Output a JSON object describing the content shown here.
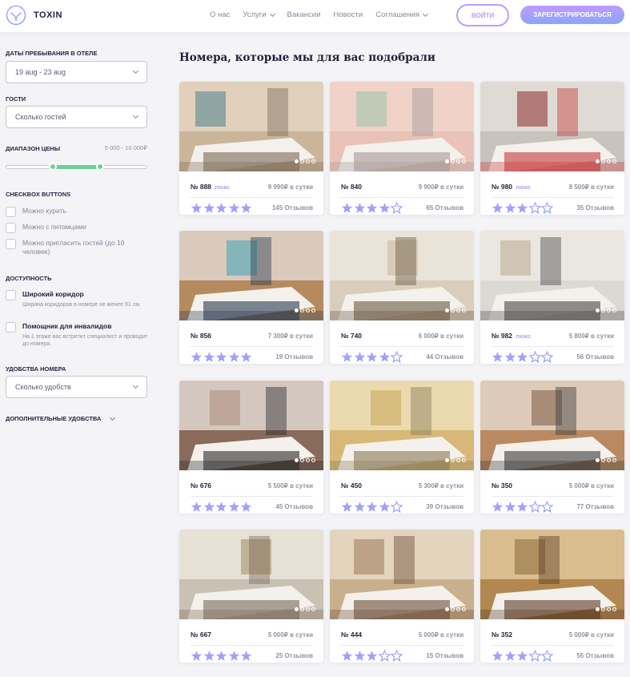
{
  "header": {
    "logo_text": "TOXIN",
    "nav": [
      {
        "label": "О нас",
        "dropdown": false
      },
      {
        "label": "Услуги",
        "dropdown": true
      },
      {
        "label": "Вакансии",
        "dropdown": false
      },
      {
        "label": "Новости",
        "dropdown": false
      },
      {
        "label": "Соглашения",
        "dropdown": true
      }
    ],
    "login_label": "войти",
    "register_label": "зарегистрироваться"
  },
  "sidebar": {
    "dates_heading": "Даты пребывания в отеле",
    "dates_value": "19 aug - 23 aug",
    "guests_heading": "Гости",
    "guests_placeholder": "Сколько гостей",
    "price_heading": "Диапазон цены",
    "price_range": "5 000 - 10 000₽",
    "price_slider": {
      "min": 0,
      "max": 15000,
      "from": 5000,
      "to": 10000
    },
    "checkboxes_heading": "checkbox buttons",
    "checkboxes": [
      {
        "label": "Можно курить",
        "checked": false
      },
      {
        "label": "Можно с питомцами",
        "checked": false
      },
      {
        "label": "Можно пригласить гостей (до 10 человек)",
        "checked": false
      }
    ],
    "accessibility_heading": "Доступность",
    "accessibility": [
      {
        "title": "Широкий коридор",
        "description": "Ширина коридоров в номере не менее 91 см.",
        "checked": false
      },
      {
        "title": "Помощник для инвалидов",
        "description": "На 1 этаже вас встретит специалист и проводит до номера.",
        "checked": false
      }
    ],
    "amenities_heading": "Удобства номера",
    "amenities_placeholder": "Сколько удобств",
    "extra_heading": "Дополнительные удобства"
  },
  "main": {
    "title": "Номера, которые мы для вас подобрали",
    "rooms": [
      {
        "number": "№ 888",
        "lux": "люкс",
        "price": "9 990₽ в сутки",
        "rating": 5,
        "reviews": "145 Отзывов"
      },
      {
        "number": "№ 840",
        "lux": "",
        "price": "9 900₽ в сутки",
        "rating": 4,
        "reviews": "65 Отзывов"
      },
      {
        "number": "№ 980",
        "lux": "люкс",
        "price": "8 500₽ в сутки",
        "rating": 3,
        "reviews": "35 Отзывов"
      },
      {
        "number": "№ 856",
        "lux": "",
        "price": "7 300₽ в сутки",
        "rating": 5,
        "reviews": "19 Отзывов"
      },
      {
        "number": "№ 740",
        "lux": "",
        "price": "6 000₽ в сутки",
        "rating": 4,
        "reviews": "44 Отзывов"
      },
      {
        "number": "№ 982",
        "lux": "люкс",
        "price": "5 800₽ в сутки",
        "rating": 3,
        "reviews": "56 Отзывов"
      },
      {
        "number": "№ 676",
        "lux": "",
        "price": "5 500₽ в сутки",
        "rating": 5,
        "reviews": "45 Отзывов"
      },
      {
        "number": "№ 450",
        "lux": "",
        "price": "5 300₽ в сутки",
        "rating": 4,
        "reviews": "39 Отзывов"
      },
      {
        "number": "№ 350",
        "lux": "",
        "price": "5 000₽ в сутки",
        "rating": 3,
        "reviews": "77 Отзывов"
      },
      {
        "number": "№ 667",
        "lux": "",
        "price": "5 000₽ в сутки",
        "rating": 5,
        "reviews": "25 Отзывов"
      },
      {
        "number": "№ 444",
        "lux": "",
        "price": "5 000₽ в сутки",
        "rating": 3,
        "reviews": "15 Отзывов"
      },
      {
        "number": "№ 352",
        "lux": "",
        "price": "5 000₽ в сутки",
        "rating": 3,
        "reviews": "55 Отзывов"
      }
    ]
  },
  "colors": {
    "accent": "#bc9cff",
    "accent_gradient_end": "#8ba4f9",
    "slider": "#6fcf97",
    "text_dark": "#1f2041"
  }
}
